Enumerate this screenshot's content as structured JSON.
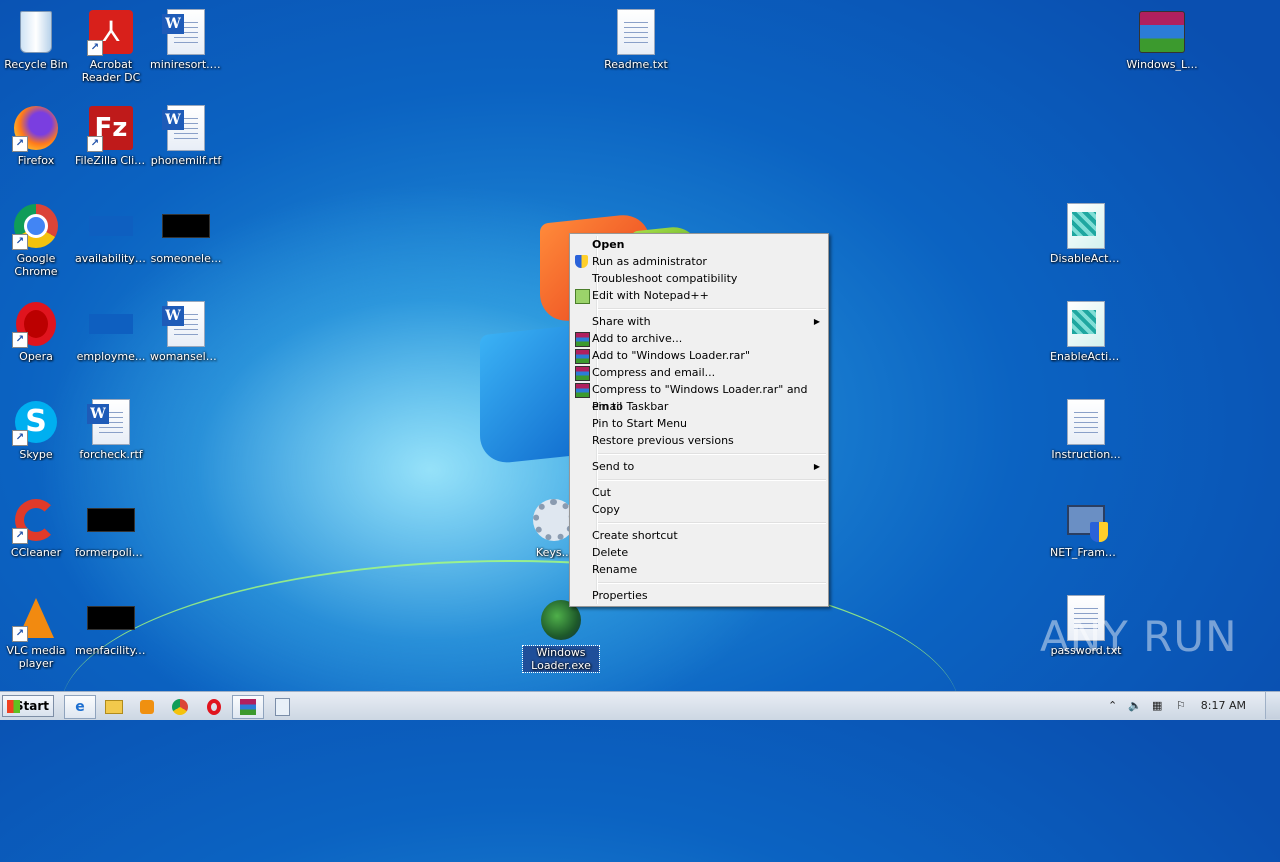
{
  "desktop": {
    "icons": [
      {
        "label": "Recycle Bin",
        "icon": "recycle-bin-icon"
      },
      {
        "label": "Acrobat Reader DC",
        "icon": "acrobat-icon"
      },
      {
        "label": "miniresort.rtf",
        "icon": "word-document-icon"
      },
      {
        "label": "Readme.txt",
        "icon": "text-file-icon"
      },
      {
        "label": "Windows_L...",
        "icon": "winrar-archive-icon"
      },
      {
        "label": "Firefox",
        "icon": "firefox-icon"
      },
      {
        "label": "FileZilla Client",
        "icon": "filezilla-icon"
      },
      {
        "label": "phonemilf.rtf",
        "icon": "word-document-icon"
      },
      {
        "label": "Google Chrome",
        "icon": "chrome-icon"
      },
      {
        "label": "availabilityp...",
        "icon": "image-icon"
      },
      {
        "label": "someonele...",
        "icon": "image-icon"
      },
      {
        "label": "DisableActiv...",
        "icon": "registry-icon"
      },
      {
        "label": "Opera",
        "icon": "opera-icon"
      },
      {
        "label": "employme...",
        "icon": "image-icon"
      },
      {
        "label": "womanselec...",
        "icon": "word-document-icon"
      },
      {
        "label": "EnableActiv...",
        "icon": "registry-icon"
      },
      {
        "label": "Skype",
        "icon": "skype-icon"
      },
      {
        "label": "forcheck.rtf",
        "icon": "word-document-icon"
      },
      {
        "label": "Instruction...",
        "icon": "text-file-icon"
      },
      {
        "label": "CCleaner",
        "icon": "ccleaner-icon"
      },
      {
        "label": "formerpolic...",
        "icon": "image-icon"
      },
      {
        "label": "Keys...",
        "icon": "settings-file-icon"
      },
      {
        "label": "NET_Frame...",
        "icon": "installer-icon"
      },
      {
        "label": "VLC media player",
        "icon": "vlc-icon"
      },
      {
        "label": "menfacility.jpg",
        "icon": "image-icon"
      },
      {
        "label": "Windows Loader.exe",
        "icon": "windows-loader-icon"
      },
      {
        "label": "password.txt",
        "icon": "text-file-icon"
      }
    ]
  },
  "context_menu": {
    "open": "Open",
    "run_as_admin": "Run as administrator",
    "troubleshoot": "Troubleshoot compatibility",
    "edit_notepad": "Edit with Notepad++",
    "share_with": "Share with",
    "add_archive": "Add to archive...",
    "add_rar": "Add to \"Windows Loader.rar\"",
    "compress_email": "Compress and email...",
    "compress_rar_email": "Compress to \"Windows Loader.rar\" and email",
    "pin_taskbar": "Pin to Taskbar",
    "pin_start": "Pin to Start Menu",
    "restore": "Restore previous versions",
    "send_to": "Send to",
    "cut": "Cut",
    "copy": "Copy",
    "create_shortcut": "Create shortcut",
    "delete": "Delete",
    "rename": "Rename",
    "properties": "Properties"
  },
  "taskbar": {
    "start_label": "Start",
    "pinned": [
      "ie-icon",
      "explorer-icon",
      "media-player-icon",
      "chrome-icon",
      "opera-icon",
      "winrar-icon",
      "notepad-icon"
    ],
    "clock": "8:17 AM"
  },
  "watermark": "ANY RUN",
  "colors": {
    "desktop_blue": "#0b63c2",
    "menu_bg": "#f0f0f0",
    "selection": "#1f4f9a"
  }
}
